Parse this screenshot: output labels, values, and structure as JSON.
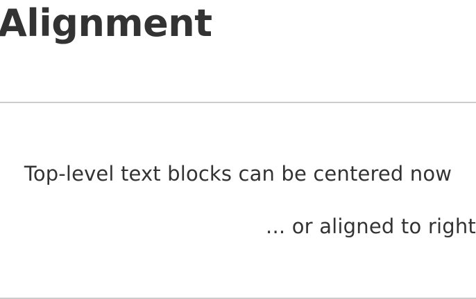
{
  "document": {
    "heading": "Alignment",
    "blocks": [
      {
        "text": "Top-level text blocks can be centered now",
        "align": "center"
      },
      {
        "text": "... or aligned to right",
        "align": "right"
      }
    ]
  }
}
